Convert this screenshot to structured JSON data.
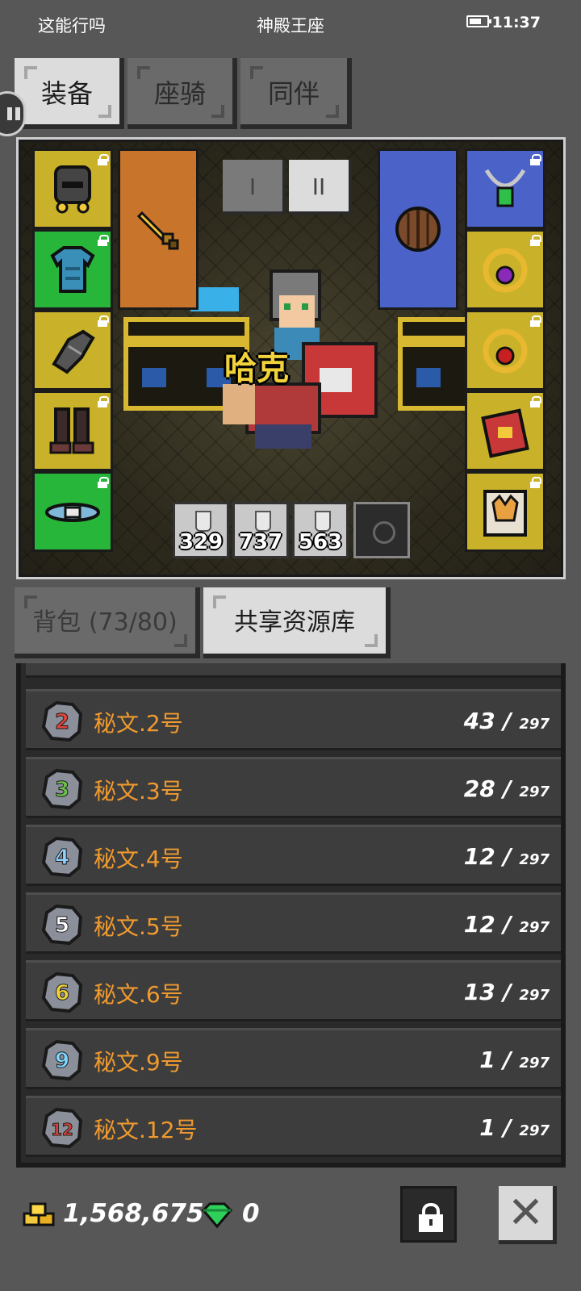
{
  "status_bar": {
    "left_text": "这能行吗",
    "center_text": "神殿王座",
    "time": "11:37",
    "battery_level": 0.7
  },
  "top_tabs": [
    {
      "label": "装备",
      "active": true
    },
    {
      "label": "座骑",
      "active": false
    },
    {
      "label": "同伴",
      "active": false
    }
  ],
  "scene": {
    "hero_name": "哈克",
    "loadout_tabs": [
      "I",
      "II"
    ],
    "active_loadout": "II",
    "left_slots": [
      {
        "name": "helmet",
        "color": "#c9b22a"
      },
      {
        "name": "armor",
        "color": "#27b53a"
      },
      {
        "name": "gloves",
        "color": "#c9b22a"
      },
      {
        "name": "boots",
        "color": "#c9b22a"
      },
      {
        "name": "belt",
        "color": "#27b53a"
      }
    ],
    "right_slots": [
      {
        "name": "necklace",
        "color": "#4b62c8"
      },
      {
        "name": "ring-purple",
        "color": "#c9b22a"
      },
      {
        "name": "ring-red",
        "color": "#c9b22a"
      },
      {
        "name": "book",
        "color": "#c9b22a"
      },
      {
        "name": "pet-card",
        "color": "#c9b22a"
      }
    ],
    "main_weapon_color": "#c9742b",
    "offhand_color": "#4b62c8",
    "potions": [
      "329",
      "737",
      "563"
    ]
  },
  "bottom_tabs": [
    {
      "label": "背包 (73/80)",
      "active": false
    },
    {
      "label": "共享资源库",
      "active": true
    }
  ],
  "rune_list": [
    {
      "label": "秘文.2号",
      "count": "43 /",
      "max": "297",
      "digit": "2",
      "digit_color": "#e0443a"
    },
    {
      "label": "秘文.3号",
      "count": "28 /",
      "max": "297",
      "digit": "3",
      "digit_color": "#6cc24a"
    },
    {
      "label": "秘文.4号",
      "count": "12 /",
      "max": "297",
      "digit": "4",
      "digit_color": "#8fd0ff"
    },
    {
      "label": "秘文.5号",
      "count": "12 /",
      "max": "297",
      "digit": "5",
      "digit_color": "#ffffff"
    },
    {
      "label": "秘文.6号",
      "count": "13 /",
      "max": "297",
      "digit": "6",
      "digit_color": "#f2d23a"
    },
    {
      "label": "秘文.9号",
      "count": "1 /",
      "max": "297",
      "digit": "9",
      "digit_color": "#7fd8ff"
    },
    {
      "label": "秘文.12号",
      "count": "1 /",
      "max": "297",
      "digit": "12",
      "digit_color": "#e0443a"
    }
  ],
  "footer": {
    "gold": "1,568,675",
    "gems": "0"
  }
}
